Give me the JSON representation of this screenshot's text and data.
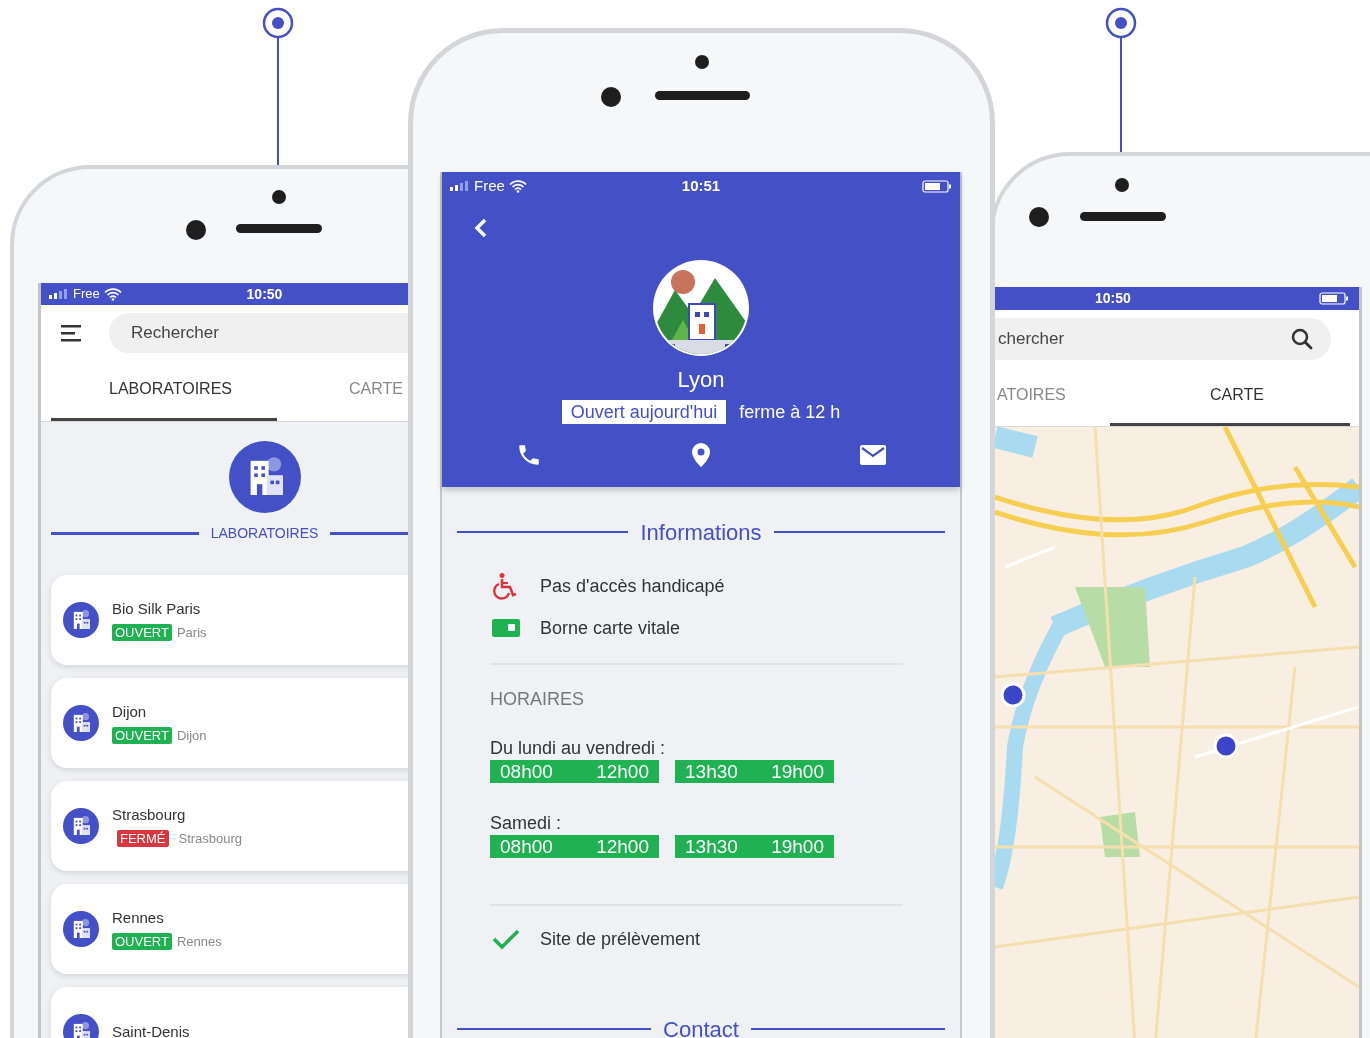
{
  "left_phone": {
    "status_bar": {
      "carrier": "Free",
      "time": "10:50"
    },
    "search": {
      "placeholder": "Rechercher"
    },
    "tabs": [
      {
        "label": "LABORATOIRES",
        "selected": true
      },
      {
        "label": "CARTE",
        "selected": false
      }
    ],
    "section_title": "LABORATOIRES",
    "labs": [
      {
        "name": "Bio Silk Paris",
        "kind": "open",
        "status": "OUVERT",
        "city": "Paris"
      },
      {
        "name": "Dijon",
        "kind": "open",
        "status": "OUVERT",
        "city": "Dijon"
      },
      {
        "name": "Strasbourg",
        "kind": "closed",
        "status": "FERMÉ",
        "city": "Strasbourg"
      },
      {
        "name": "Rennes",
        "kind": "open",
        "status": "OUVERT",
        "city": "Rennes"
      },
      {
        "name": "Saint-Denis"
      }
    ]
  },
  "detail_phone": {
    "status_bar": {
      "carrier": "Free",
      "time": "10:51"
    },
    "title": "Lyon",
    "open_badge": "Ouvert aujourd'hui",
    "closing": "ferme à 12 h",
    "section_title": "Informations",
    "features": [
      {
        "kind": "accessibility",
        "text": "Pas d'accès handicapé"
      },
      {
        "kind": "card",
        "text": "Borne carte vitale"
      }
    ],
    "hours_title": "HORAIRES",
    "schedules": [
      {
        "days": "Du lundi au vendredi :",
        "slots": [
          {
            "from": "08h00",
            "to": "12h00"
          },
          {
            "from": "13h30",
            "to": "19h00"
          }
        ]
      },
      {
        "days": "Samedi :",
        "slots": [
          {
            "from": "08h00",
            "to": "12h00"
          },
          {
            "from": "13h30",
            "to": "19h00"
          }
        ]
      }
    ],
    "checks": [
      {
        "text": "Site de prélèvement",
        "checked": true
      }
    ],
    "contact_title": "Contact"
  },
  "map_phone": {
    "status_bar": {
      "time": "10:50"
    },
    "search": {
      "placeholder": "chercher"
    },
    "tabs": [
      {
        "label": "ATOIRES",
        "selected": false
      },
      {
        "label": "CARTE",
        "selected": true
      }
    ]
  }
}
